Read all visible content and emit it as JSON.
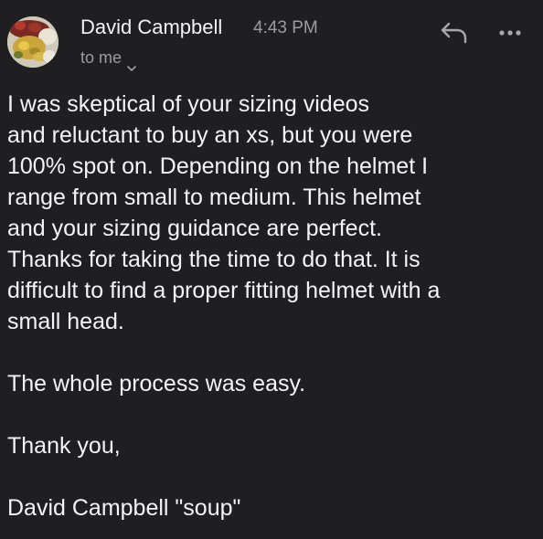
{
  "sender": {
    "name": "David Campbell",
    "time": "4:43 PM",
    "recipient_label": "to me"
  },
  "icons": {
    "avatar": "food-photo-avatar",
    "reply": "reply-arrow-icon",
    "more": "more-horizontal-icon",
    "expand": "chevron-down-icon"
  },
  "colors": {
    "background": "#1f1f21",
    "primary_text": "#f4f4f4",
    "secondary_text": "#9c9ca0"
  },
  "message": {
    "paragraph_1": "I was skeptical of your sizing videos\nand reluctant to buy an xs, but you were\n100% spot on. Depending on the helmet I\nrange from small to medium. This helmet\nand your sizing guidance are perfect.\nThanks for taking the time to do that. It is\ndifficult to find a proper fitting helmet with a\nsmall head.",
    "paragraph_2": "The whole process was easy.",
    "paragraph_3": "Thank you,",
    "paragraph_4": "David Campbell \"soup\""
  }
}
